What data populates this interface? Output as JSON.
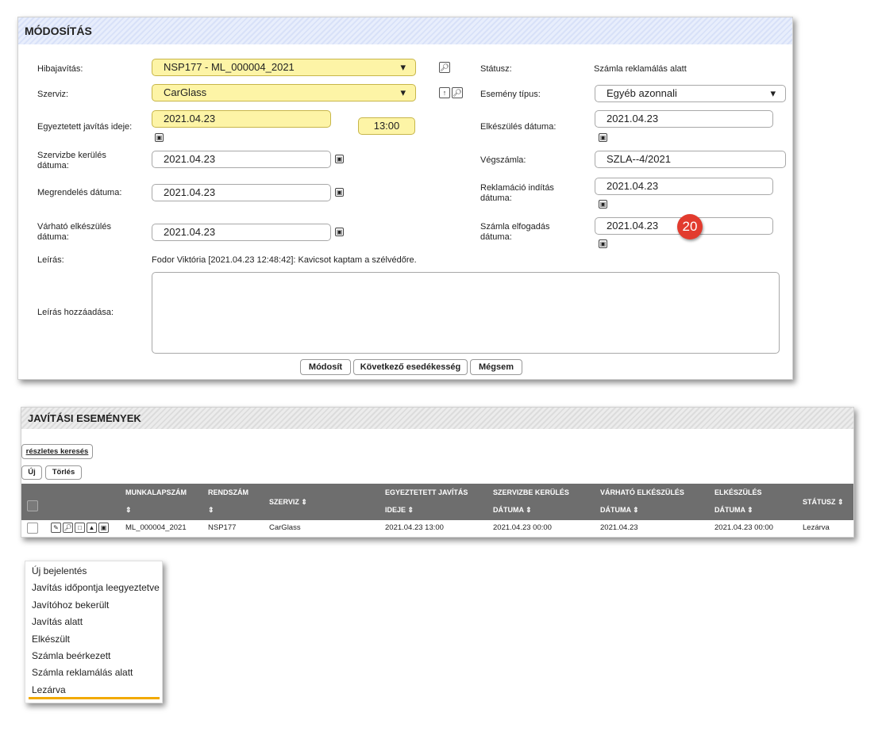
{
  "form": {
    "title": "MÓDOSÍTÁS",
    "labels": {
      "hibajavitas": "Hibajavítás:",
      "szerviz": "Szerviz:",
      "egyeztetett": "Egyeztetett javítás ideje:",
      "szervizbe_1": "Szervizbe kerülés",
      "szervizbe_2": "dátuma:",
      "megrendeles": "Megrendelés dátuma:",
      "varhato_1": "Várható elkészülés",
      "varhato_2": "dátuma:",
      "leiras": "Leírás:",
      "leiras_add": "Leírás hozzáadása:",
      "statusz": "Státusz:",
      "esemeny": "Esemény típus:",
      "elkeszules": "Elkészülés dátuma:",
      "vegszamla": "Végszámla:",
      "reklamacio_1": "Reklamáció indítás",
      "reklamacio_2": "dátuma:",
      "szamla_1": "Számla elfogadás",
      "szamla_2": "dátuma:"
    },
    "values": {
      "hibajavitas": "NSP177 - ML_000004_2021",
      "szerviz": "CarGlass",
      "egyeztetett_date": "2021.04.23",
      "egyeztetett_time": "13:00",
      "szervizbe": "2021.04.23",
      "megrendeles": "2021.04.23",
      "varhato": "2021.04.23",
      "leiras_text": "Fodor Viktória [2021.04.23 12:48:42]: Kavicsot kaptam a szélvédőre.",
      "statusz": "Számla reklamálás alatt",
      "esemeny": "Egyéb azonnali",
      "elkeszules": "2021.04.23",
      "vegszamla": "SZLA--4/2021",
      "reklamacio": "2021.04.23",
      "szamla_elfogadas": "2021.04.23"
    },
    "badge": "20",
    "buttons": {
      "modosit": "Módosít",
      "kovetkezo": "Következő esedékesség",
      "megsem": "Mégsem"
    }
  },
  "events": {
    "title": "JAVÍTÁSI ESEMÉNYEK",
    "search_link": "részletes keresés",
    "new_button": "Új",
    "delete_button": "Törlés",
    "columns": [
      {
        "l1": "MUNKALAPSZÁM",
        "l2": "⇕"
      },
      {
        "l1": "RENDSZÁM",
        "l2": "⇕"
      },
      {
        "l1": "SZERVIZ ⇕",
        "l2": ""
      },
      {
        "l1": "EGYEZTETETT JAVÍTÁS",
        "l2": "IDEJE ⇕"
      },
      {
        "l1": "SZERVIZBE KERÜLÉS",
        "l2": "DÁTUMA ⇕"
      },
      {
        "l1": "VÁRHATÓ ELKÉSZÜLÉS",
        "l2": "DÁTUMA ⇕"
      },
      {
        "l1": "ELKÉSZÜLÉS",
        "l2": "DÁTUMA ⇕"
      },
      {
        "l1": "STÁTUSZ ⇕",
        "l2": ""
      }
    ],
    "row": [
      "ML_000004_2021",
      "NSP177",
      "CarGlass",
      "2021.04.23 13:00",
      "2021.04.23 00:00",
      "2021.04.23",
      "2021.04.23 00:00",
      "Lezárva"
    ]
  },
  "status_menu": {
    "items": [
      "Új bejelentés",
      "Javítás időpontja leegyeztetve",
      "Javítóhoz bekerült",
      "Javítás alatt",
      "Elkészült",
      "Számla beérkezett",
      "Számla reklamálás alatt",
      "Lezárva"
    ],
    "highlight_color": "#f2a900"
  },
  "icons": {
    "search": "magnifier-icon",
    "calendar": "calendar-icon",
    "up": "arrow-up-icon"
  }
}
